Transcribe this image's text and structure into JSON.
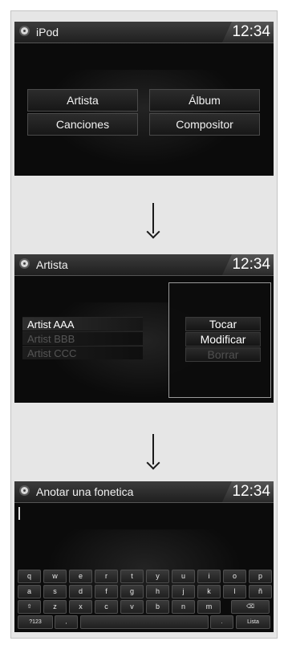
{
  "screen1": {
    "title": "iPod",
    "clock": "12:34",
    "buttons": [
      "Artista",
      "Álbum",
      "Canciones",
      "Compositor"
    ]
  },
  "screen2": {
    "title": "Artista",
    "clock": "12:34",
    "list": [
      "Artist AAA",
      "Artist BBB",
      "Artist CCC"
    ],
    "menu": [
      "Tocar",
      "Modificar",
      "Borrar"
    ]
  },
  "screen3": {
    "title": "Anotar una fonetica",
    "clock": "12:34",
    "keyboard": {
      "row1": [
        "q",
        "w",
        "e",
        "r",
        "t",
        "y",
        "u",
        "i",
        "o",
        "p"
      ],
      "row2": [
        "a",
        "s",
        "d",
        "f",
        "g",
        "h",
        "j",
        "k",
        "l",
        "ñ"
      ],
      "row3": [
        "⇧",
        "z",
        "x",
        "c",
        "v",
        "b",
        "n",
        "m",
        "⌫"
      ],
      "row4": [
        "?123",
        ",",
        "",
        ".",
        "Lista"
      ]
    }
  },
  "arrows": [
    "↓",
    "↓"
  ]
}
